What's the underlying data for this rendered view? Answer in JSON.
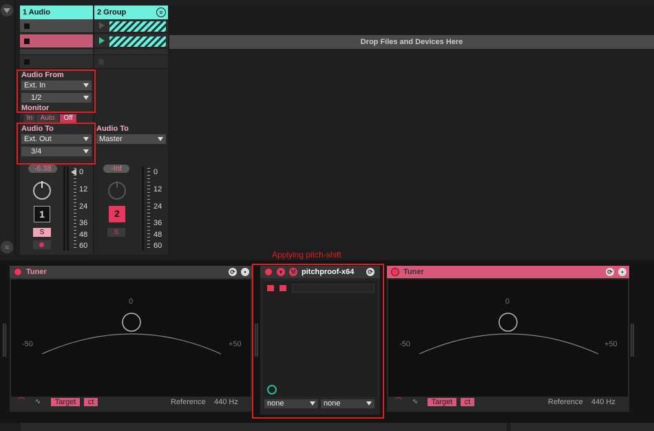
{
  "tracks": [
    {
      "name": "1 Audio",
      "number": "1",
      "volume": "-6.38",
      "solo": "S"
    },
    {
      "name": "2 Group",
      "number": "2",
      "volume": "-Inf",
      "solo": "S"
    }
  ],
  "session": {
    "drop_zone": "Drop Files and Devices Here"
  },
  "io": {
    "audio_from_label": "Audio From",
    "audio_from_value": "Ext. In",
    "audio_from_channel": "1/2",
    "monitor_label": "Monitor",
    "monitor_in": "In",
    "monitor_auto": "Auto",
    "monitor_off": "Off",
    "audio_to_label": "Audio To",
    "audio_to_value": "Ext. Out",
    "audio_to_channel": "3/4",
    "group_audio_to_label": "Audio To",
    "group_audio_to_value": "Master"
  },
  "meter_scale": [
    "0",
    "12",
    "24",
    "36",
    "48",
    "60"
  ],
  "devices": {
    "tuner1": {
      "title": "Tuner",
      "center": "0",
      "left": "-50",
      "right": "+50",
      "target": "Target",
      "ct": "ct",
      "reference_label": "Reference",
      "reference_value": "440 Hz"
    },
    "pitchproof": {
      "title": "pitchproof-x64",
      "select1": "none",
      "select2": "none"
    },
    "tuner2": {
      "title": "Tuner",
      "center": "0",
      "left": "-50",
      "right": "+50",
      "target": "Target",
      "ct": "ct",
      "reference_label": "Reference",
      "reference_value": "440 Hz"
    }
  },
  "annotation": "Applying pitch-shift",
  "colors": {
    "track_head": "#6ff0dc",
    "accent": "#e8375a",
    "highlight": "#e02020"
  }
}
